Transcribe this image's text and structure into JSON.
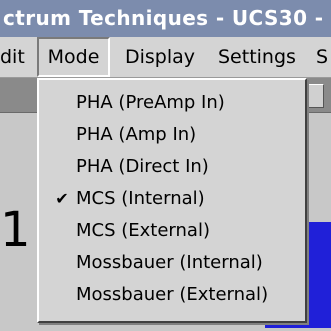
{
  "window": {
    "title": "ctrum Techniques - UCS30 -"
  },
  "menubar": {
    "edit": "dit",
    "mode": "Mode",
    "display": "Display",
    "settings": "Settings",
    "more": "S"
  },
  "dropdown": {
    "items": [
      {
        "label": "PHA (PreAmp In)",
        "checked": false
      },
      {
        "label": "PHA (Amp In)",
        "checked": false
      },
      {
        "label": "PHA (Direct In)",
        "checked": false
      },
      {
        "label": "MCS (Internal)",
        "checked": true,
        "check_glyph": "✔"
      },
      {
        "label": "MCS (External)",
        "checked": false
      },
      {
        "label": "Mossbauer (Internal)",
        "checked": false
      },
      {
        "label": "Mossbauer (External)",
        "checked": false
      }
    ]
  },
  "content": {
    "partial_text": "1"
  },
  "colors": {
    "titlebar_bg": "#7c8cad",
    "menu_bg": "#d4d4d4",
    "plot_bg": "#2020d8"
  }
}
